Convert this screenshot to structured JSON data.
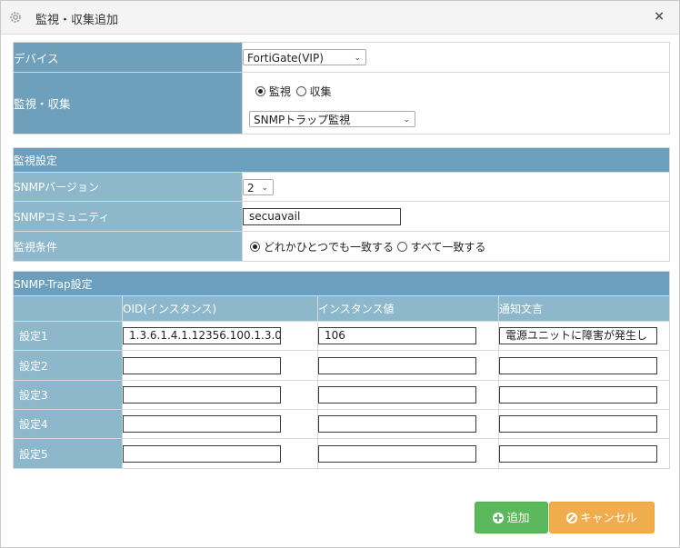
{
  "dialog": {
    "title": "監視・収集追加",
    "close_glyph": "×",
    "title_icon": "gear-icon"
  },
  "device_section": {
    "device_label": "デバイス",
    "device_value": "FortiGate(VIP)",
    "monitor_label": "監視・収集",
    "radio_monitor": "監視",
    "radio_collect": "収集",
    "selected_mode": "監視",
    "monitor_type_value": "SNMPトラップ監視"
  },
  "monitor_settings": {
    "header": "監視設定",
    "snmp_version_label": "SNMPバージョン",
    "snmp_version_value": "2",
    "community_label": "SNMPコミュニティ",
    "community_value": "secuavail",
    "condition_label": "監視条件",
    "condition_any": "どれかひとつでも一致する",
    "condition_all": "すべて一致する",
    "selected_condition": "どれかひとつでも一致する"
  },
  "trap_settings": {
    "header": "SNMP-Trap設定",
    "columns": [
      "OID(インスタンス)",
      "インスタンス値",
      "通知文言"
    ],
    "rows": [
      {
        "label": "設定1",
        "oid": "1.3.6.1.4.1.12356.100.1.3.0",
        "value": "106",
        "message": "電源ユニットに障害が発生し"
      },
      {
        "label": "設定2",
        "oid": "",
        "value": "",
        "message": ""
      },
      {
        "label": "設定3",
        "oid": "",
        "value": "",
        "message": ""
      },
      {
        "label": "設定4",
        "oid": "",
        "value": "",
        "message": ""
      },
      {
        "label": "設定5",
        "oid": "",
        "value": "",
        "message": ""
      }
    ]
  },
  "buttons": {
    "add_label": "追加",
    "cancel_label": "キャンセル"
  },
  "colors": {
    "label_bg": "#6e9fbb",
    "sub_label_bg": "#8db8cc",
    "add_button": "#5cb85c",
    "cancel_button": "#f0ad4e"
  }
}
